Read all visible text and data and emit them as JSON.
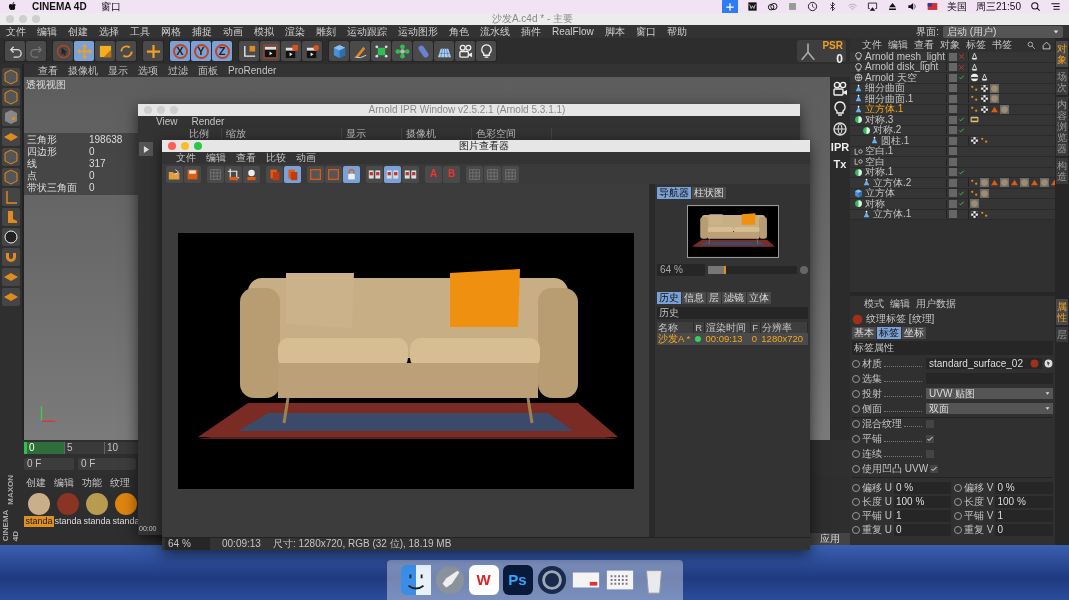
{
  "menubar": {
    "app": "CINEMA 4D",
    "menus": [
      "窗口"
    ],
    "input_source": "美国",
    "clock": "周三21:50"
  },
  "window": {
    "title": "沙发A.c4d * - 主要"
  },
  "menu": [
    "文件",
    "编辑",
    "创建",
    "选择",
    "工具",
    "网格",
    "捕捉",
    "动画",
    "模拟",
    "渲染",
    "雕刻",
    "运动跟踪",
    "运动图形",
    "角色",
    "流水线",
    "插件",
    "RealFlow",
    "脚本",
    "窗口",
    "帮助"
  ],
  "layout": {
    "label": "界面:",
    "value": "启动 (用户)"
  },
  "toolbar": {
    "tools": [
      {
        "kind": "undo",
        "active": false
      },
      {
        "kind": "redo",
        "active": false
      },
      {
        "kind": "select",
        "active": false
      },
      {
        "kind": "move",
        "active": true
      },
      {
        "kind": "scale",
        "active": false
      },
      {
        "kind": "rotate",
        "active": false
      },
      {
        "kind": "add",
        "active": false
      }
    ],
    "axes": [
      {
        "label": "X",
        "active": true
      },
      {
        "label": "Y",
        "active": true
      },
      {
        "label": "Z",
        "active": true
      }
    ],
    "render": [
      {
        "kind": "coord"
      },
      {
        "kind": "clap"
      },
      {
        "kind": "clap2"
      },
      {
        "kind": "clap3"
      }
    ],
    "create": [
      {
        "kind": "cube"
      },
      {
        "kind": "pen"
      },
      {
        "kind": "subdiv"
      },
      {
        "kind": "cloner"
      },
      {
        "kind": "deformer"
      },
      {
        "kind": "floor"
      },
      {
        "kind": "camera"
      },
      {
        "kind": "bulb"
      }
    ]
  },
  "psr": {
    "label": "PSR",
    "value": "0"
  },
  "viewport": {
    "menu": [
      "查看",
      "摄像机",
      "显示",
      "选项",
      "过滤",
      "面板",
      "ProRender"
    ],
    "name": "透视视图",
    "stats": [
      {
        "label": "三角形",
        "value": "198638"
      },
      {
        "label": "四边形",
        "value": "0"
      },
      {
        "label": "线",
        "value": "317"
      },
      {
        "label": "点",
        "value": "0"
      },
      {
        "label": "带状三角面",
        "value": "0"
      }
    ],
    "side_buttons": [
      {
        "kind": "camera"
      },
      {
        "kind": "bulb"
      },
      {
        "kind": "globe"
      },
      {
        "kind": "text",
        "label": "IPR"
      },
      {
        "kind": "text",
        "label": "Tx"
      }
    ]
  },
  "timeline": {
    "ticks": [
      "0",
      "5",
      "10"
    ],
    "start": "0 F",
    "current": "0 F"
  },
  "logo": [
    "MAXON",
    "CINEMA 4D"
  ],
  "materials": {
    "menu": [
      "创建",
      "编辑",
      "功能",
      "纹理"
    ],
    "items": [
      {
        "name": "standa",
        "color": "#c9b08a",
        "selected": true
      },
      {
        "name": "standa",
        "color": "#8a3424",
        "selected": false
      },
      {
        "name": "standa",
        "color": "#b89a50",
        "selected": false
      },
      {
        "name": "standa",
        "color": "#e08410",
        "selected": false
      }
    ]
  },
  "apply_button": "应用",
  "objects": {
    "menu": [
      "文件",
      "编辑",
      "查看",
      "对象",
      "标签",
      "书签"
    ],
    "tree": [
      {
        "name": "Arnold mesh_light",
        "kind": "bulb",
        "enabled": false,
        "selected": false,
        "tags": [
          {
            "kind": "arnold"
          }
        ]
      },
      {
        "name": "Arnold disk_light",
        "kind": "bulb",
        "enabled": false,
        "selected": false,
        "tags": [
          {
            "kind": "arnold"
          }
        ]
      },
      {
        "name": "Arnold 天空",
        "kind": "globe",
        "enabled": true,
        "selected": false,
        "tags": [
          {
            "kind": "skytag"
          },
          {
            "kind": "arnold"
          }
        ]
      },
      {
        "name": "细分曲面",
        "kind": "polygon",
        "selected": false,
        "tags": [
          {
            "kind": "phong"
          },
          {
            "kind": "uv"
          },
          {
            "kind": "material"
          }
        ]
      },
      {
        "name": "细分曲面.1",
        "kind": "polygon",
        "selected": false,
        "tags": [
          {
            "kind": "phong"
          },
          {
            "kind": "uv"
          },
          {
            "kind": "material"
          }
        ]
      },
      {
        "name": "立方体.1",
        "kind": "polygon",
        "selected": true,
        "tags": [
          {
            "kind": "phong"
          },
          {
            "kind": "uv"
          },
          {
            "kind": "warning"
          },
          {
            "kind": "material"
          }
        ]
      },
      {
        "name": "对称.3",
        "kind": "symmetry",
        "enabled": true,
        "selected": false,
        "tags": [
          {
            "kind": "display"
          }
        ],
        "children": [
          {
            "name": "对称.2",
            "kind": "symmetry",
            "enabled": true,
            "selected": false,
            "children": [
              {
                "name": "圆柱.1",
                "kind": "polygon",
                "selected": false,
                "tags": [
                  {
                    "kind": "uv"
                  },
                  {
                    "kind": "phong"
                  }
                ]
              }
            ]
          }
        ]
      },
      {
        "name": "空白.1",
        "kind": "null",
        "selected": false
      },
      {
        "name": "空白",
        "kind": "null",
        "selected": false
      },
      {
        "name": "对称.1",
        "kind": "symmetry",
        "enabled": true,
        "selected": false,
        "children": [
          {
            "name": "立方体.2",
            "kind": "polygon",
            "selected": false,
            "tags": [
              {
                "kind": "phong"
              },
              {
                "kind": "material"
              },
              {
                "kind": "warning"
              },
              {
                "kind": "material"
              },
              {
                "kind": "warning"
              },
              {
                "kind": "material"
              },
              {
                "kind": "warning"
              },
              {
                "kind": "material"
              },
              {
                "kind": "warning"
              }
            ]
          }
        ]
      },
      {
        "name": "立方体",
        "kind": "cube",
        "enabled": true,
        "selected": false,
        "tags": [
          {
            "kind": "phong"
          },
          {
            "kind": "material"
          }
        ]
      },
      {
        "name": "对称",
        "kind": "symmetry",
        "enabled": true,
        "selected": false,
        "tags": [
          {
            "kind": "material"
          }
        ],
        "children": [
          {
            "name": "立方体.1",
            "kind": "polygon",
            "selected": false,
            "tags": [
              {
                "kind": "uv"
              },
              {
                "kind": "phong"
              }
            ]
          }
        ]
      }
    ]
  },
  "side_tabs": [
    {
      "label": "对象",
      "selected": true
    },
    {
      "label": "场次",
      "selected": false
    },
    {
      "label": "内容浏览器",
      "selected": false
    },
    {
      "label": "构造",
      "selected": false
    }
  ],
  "attributes": {
    "menu": [
      "模式",
      "编辑",
      "用户数据"
    ],
    "title": "纹理标签 [纹理]",
    "tabs": [
      {
        "label": "基本",
        "selected": false
      },
      {
        "label": "标签",
        "selected": true
      },
      {
        "label": "坐标",
        "selected": false
      }
    ],
    "section": "标签属性",
    "fields": [
      {
        "kind": "link",
        "label": "材质",
        "value": "standard_surface_02"
      },
      {
        "kind": "text",
        "label": "选集"
      },
      {
        "kind": "select",
        "label": "投射",
        "value": "UVW 贴图"
      },
      {
        "kind": "select",
        "label": "侧面",
        "value": "双面"
      }
    ],
    "options": [
      {
        "label": "混合纹理",
        "checked": false
      },
      {
        "label": "平铺",
        "checked": true
      },
      {
        "label": "连续",
        "checked": false
      },
      {
        "label": "使用凹凸 UVW",
        "checked": true
      }
    ],
    "numbers": [
      {
        "label": "偏移 U",
        "value": "0 %"
      },
      {
        "label": "偏移 V",
        "value": "0 %"
      },
      {
        "label": "长度 U",
        "value": "100 %"
      },
      {
        "label": "长度 V",
        "value": "100 %"
      },
      {
        "label": "平铺 U",
        "value": "1"
      },
      {
        "label": "平铺 V",
        "value": "1"
      },
      {
        "label": "重复 U",
        "value": "0"
      },
      {
        "label": "重复 V",
        "value": "0"
      }
    ]
  },
  "attr_side_tabs": [
    {
      "label": "属性",
      "selected": true
    },
    {
      "label": "层",
      "selected": false
    }
  ],
  "ipr_window": {
    "title": "Arnold IPR Window v2.5.2.1 (Arnold 5.3.1.1)",
    "menu": [
      "View",
      "Render"
    ],
    "columns": [
      "比例",
      "缩放",
      "显示",
      "摄像机",
      "色彩空间"
    ],
    "time": "00:00"
  },
  "picture_viewer": {
    "title": "图片查看器",
    "menu": [
      "文件",
      "编辑",
      "查看",
      "比较",
      "动画"
    ],
    "toolbar": [
      {
        "kind": "open",
        "active": false
      },
      {
        "kind": "save",
        "active": false
      },
      {
        "kind": "grid",
        "active": false
      },
      {
        "kind": "region",
        "active": false
      },
      {
        "kind": "snapshot",
        "active": false
      },
      {
        "kind": "copy",
        "active": false
      },
      {
        "kind": "copy",
        "active": true
      },
      {
        "kind": "frame",
        "active": false
      },
      {
        "kind": "frame",
        "active": false
      },
      {
        "kind": "lock",
        "active": true
      },
      {
        "kind": "split",
        "active": false
      },
      {
        "kind": "split",
        "active": true
      },
      {
        "kind": "split",
        "active": false
      },
      {
        "kind": "mark",
        "label": "A",
        "active": false
      },
      {
        "kind": "mark",
        "label": "B",
        "active": false
      },
      {
        "kind": "grid",
        "active": false
      },
      {
        "kind": "grid",
        "active": false
      },
      {
        "kind": "grid",
        "active": false
      }
    ],
    "navigator": {
      "tabs": [
        {
          "label": "导航器",
          "selected": true
        },
        {
          "label": "柱状图",
          "selected": false
        }
      ],
      "zoom": "64 %",
      "level": 0.2
    },
    "history": {
      "tabs": [
        {
          "label": "历史",
          "selected": true
        },
        {
          "label": "信息",
          "selected": false
        },
        {
          "label": "层",
          "selected": false
        },
        {
          "label": "滤镜",
          "selected": false
        },
        {
          "label": "立体",
          "selected": false
        }
      ],
      "section": "历史",
      "columns": [
        "名称",
        "R",
        "渲染时间",
        "F",
        "分辨率"
      ],
      "rows": [
        {
          "name": "沙发A *",
          "color": "#33d25a",
          "time": "00:09:13",
          "frame": "0",
          "resolution": "1280x720"
        }
      ]
    },
    "status": {
      "zoom": "64 %",
      "time": "00:09:13",
      "info": "尺寸: 1280x720, RGB (32 位), 18.19 MB"
    }
  },
  "dock": [
    {
      "kind": "finder"
    },
    {
      "kind": "launchpad"
    },
    {
      "kind": "app",
      "label": "W"
    },
    {
      "kind": "app",
      "label": "Ps"
    },
    {
      "kind": "cinema"
    },
    {
      "kind": "screenshot"
    },
    {
      "kind": "keyboard"
    },
    {
      "kind": "trash"
    }
  ]
}
